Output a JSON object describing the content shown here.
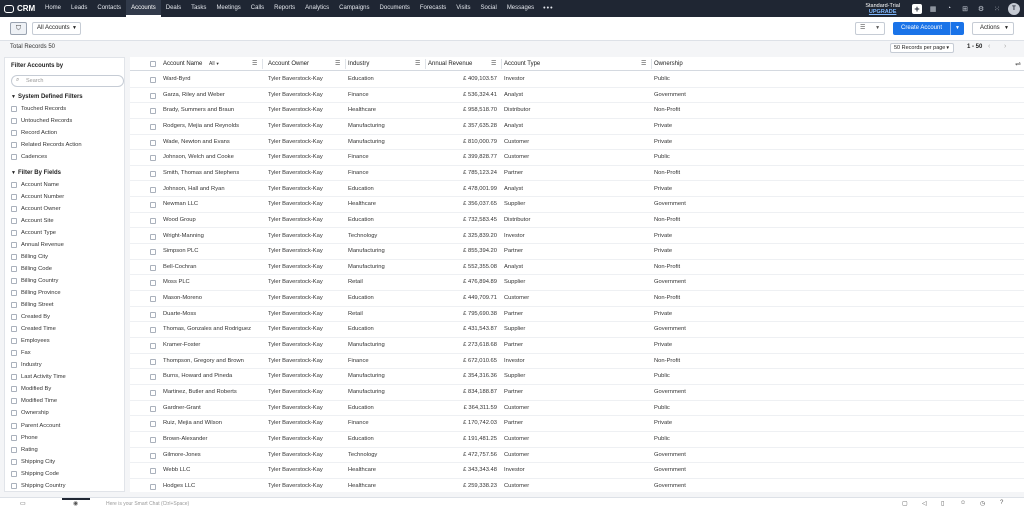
{
  "app": {
    "name": "CRM"
  },
  "nav": {
    "tabs": [
      "Home",
      "Leads",
      "Contacts",
      "Accounts",
      "Deals",
      "Tasks",
      "Meetings",
      "Calls",
      "Reports",
      "Analytics",
      "Campaigns",
      "Documents",
      "Forecasts",
      "Visits",
      "Social",
      "Messages"
    ],
    "active": "Accounts",
    "more": "•••",
    "trial_label": "Standard-Trial",
    "upgrade_label": "UPGRADE",
    "avatar_initial": "T"
  },
  "subheader": {
    "view": "All Accounts",
    "create_label": "Create Account",
    "actions_label": "Actions"
  },
  "records": {
    "total_label": "Total Records 50",
    "per_page": "50 Records per page",
    "range": "1 - 50"
  },
  "sidebar": {
    "title": "Filter Accounts by",
    "search_placeholder": "Search",
    "system_title": "System Defined Filters",
    "system_filters": [
      "Touched Records",
      "Untouched Records",
      "Record Action",
      "Related Records Action",
      "Cadences"
    ],
    "fields_title": "Filter By Fields",
    "field_filters": [
      "Account Name",
      "Account Number",
      "Account Owner",
      "Account Site",
      "Account Type",
      "Annual Revenue",
      "Billing City",
      "Billing Code",
      "Billing Country",
      "Billing Province",
      "Billing Street",
      "Created By",
      "Created Time",
      "Employees",
      "Fax",
      "Industry",
      "Last Activity Time",
      "Modified By",
      "Modified Time",
      "Ownership",
      "Parent Account",
      "Phone",
      "Rating",
      "Shipping City",
      "Shipping Code",
      "Shipping Country"
    ]
  },
  "table": {
    "columns": [
      "Account Name",
      "Account Owner",
      "Industry",
      "Annual Revenue",
      "Account Type",
      "Ownership"
    ],
    "all_label": "All",
    "rows": [
      [
        "Ward-Byrd",
        "Tyler Baverstock-Kay",
        "Education",
        "£ 409,103.57",
        "Investor",
        "Public"
      ],
      [
        "Garza, Riley and Weber",
        "Tyler Baverstock-Kay",
        "Finance",
        "£ 536,324.41",
        "Analyst",
        "Government"
      ],
      [
        "Brady, Summers and Braun",
        "Tyler Baverstock-Kay",
        "Healthcare",
        "£ 958,518.70",
        "Distributor",
        "Non-Profit"
      ],
      [
        "Rodgers, Mejia and Reynolds",
        "Tyler Baverstock-Kay",
        "Manufacturing",
        "£ 357,635.28",
        "Analyst",
        "Private"
      ],
      [
        "Wade, Newton and Evans",
        "Tyler Baverstock-Kay",
        "Manufacturing",
        "£ 810,000.79",
        "Customer",
        "Private"
      ],
      [
        "Johnson, Welch and Cooke",
        "Tyler Baverstock-Kay",
        "Finance",
        "£ 399,828.77",
        "Customer",
        "Public"
      ],
      [
        "Smith, Thomas and Stephens",
        "Tyler Baverstock-Kay",
        "Finance",
        "£ 785,123.24",
        "Partner",
        "Non-Profit"
      ],
      [
        "Johnson, Hall and Ryan",
        "Tyler Baverstock-Kay",
        "Education",
        "£ 478,001.99",
        "Analyst",
        "Private"
      ],
      [
        "Newman LLC",
        "Tyler Baverstock-Kay",
        "Healthcare",
        "£ 356,037.65",
        "Supplier",
        "Government"
      ],
      [
        "Wood Group",
        "Tyler Baverstock-Kay",
        "Education",
        "£ 732,583.45",
        "Distributor",
        "Non-Profit"
      ],
      [
        "Wright-Manning",
        "Tyler Baverstock-Kay",
        "Technology",
        "£ 325,839.20",
        "Investor",
        "Private"
      ],
      [
        "Simpson PLC",
        "Tyler Baverstock-Kay",
        "Manufacturing",
        "£ 855,394.20",
        "Partner",
        "Private"
      ],
      [
        "Bell-Cochran",
        "Tyler Baverstock-Kay",
        "Manufacturing",
        "£ 552,355.08",
        "Analyst",
        "Non-Profit"
      ],
      [
        "Moss PLC",
        "Tyler Baverstock-Kay",
        "Retail",
        "£ 476,894.89",
        "Supplier",
        "Government"
      ],
      [
        "Mason-Moreno",
        "Tyler Baverstock-Kay",
        "Education",
        "£ 449,709.71",
        "Customer",
        "Non-Profit"
      ],
      [
        "Duarte-Moss",
        "Tyler Baverstock-Kay",
        "Retail",
        "£ 795,690.38",
        "Partner",
        "Private"
      ],
      [
        "Thomas, Gonzales and Rodriguez",
        "Tyler Baverstock-Kay",
        "Education",
        "£ 431,543.87",
        "Supplier",
        "Government"
      ],
      [
        "Kramer-Foster",
        "Tyler Baverstock-Kay",
        "Manufacturing",
        "£ 273,618.68",
        "Partner",
        "Private"
      ],
      [
        "Thompson, Gregory and Brown",
        "Tyler Baverstock-Kay",
        "Finance",
        "£ 672,010.65",
        "Investor",
        "Non-Profit"
      ],
      [
        "Burns, Howard and Pineda",
        "Tyler Baverstock-Kay",
        "Manufacturing",
        "£ 354,316.36",
        "Supplier",
        "Public"
      ],
      [
        "Martinez, Butler and Roberts",
        "Tyler Baverstock-Kay",
        "Manufacturing",
        "£ 834,188.87",
        "Partner",
        "Government"
      ],
      [
        "Gardner-Grant",
        "Tyler Baverstock-Kay",
        "Education",
        "£ 364,311.59",
        "Customer",
        "Public"
      ],
      [
        "Ruiz, Mejia and Wilson",
        "Tyler Baverstock-Kay",
        "Finance",
        "£ 170,742.03",
        "Partner",
        "Private"
      ],
      [
        "Brown-Alexander",
        "Tyler Baverstock-Kay",
        "Education",
        "£ 191,481.25",
        "Customer",
        "Public"
      ],
      [
        "Gilmore-Jones",
        "Tyler Baverstock-Kay",
        "Technology",
        "£ 472,757.56",
        "Customer",
        "Government"
      ],
      [
        "Webb LLC",
        "Tyler Baverstock-Kay",
        "Healthcare",
        "£ 343,343.48",
        "Investor",
        "Government"
      ],
      [
        "Hodges LLC",
        "Tyler Baverstock-Kay",
        "Healthcare",
        "£ 259,338.23",
        "Customer",
        "Government"
      ]
    ]
  },
  "footer": {
    "chat_placeholder": "Here is your Smart Chat (Ctrl+Space)"
  },
  "colors": {
    "nav_bg": "#1f2633",
    "accent": "#1a73e8"
  }
}
